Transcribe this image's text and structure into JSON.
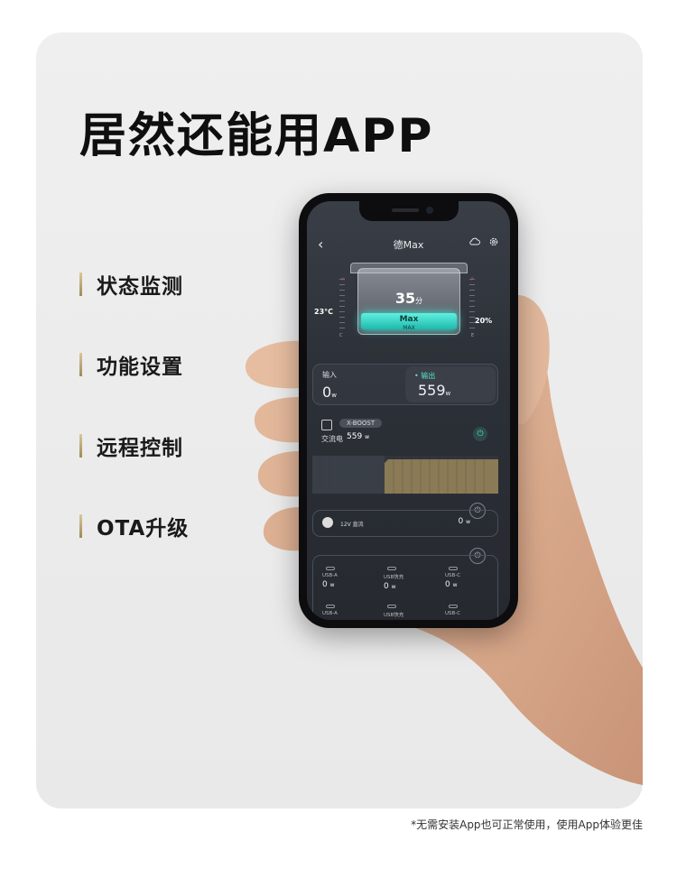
{
  "headline": "居然还能用APP",
  "features": [
    "状态监测",
    "功能设置",
    "远程控制",
    "OTA升级"
  ],
  "footnote": "*无需安装App也可正常使用，使用App体验更佳",
  "app": {
    "back_icon": "chevron-left-icon",
    "title": "德Max",
    "cloud_icon": "cloud-sync-icon",
    "settings_icon": "gear-icon",
    "device": {
      "time_value": "35",
      "time_unit": "分",
      "name": "Max",
      "label": "MAX",
      "temperature": "23°C",
      "battery": "20%",
      "gauge_left_top": "H",
      "gauge_left_bottom": "C",
      "gauge_right_top": "F",
      "gauge_right_bottom": "E"
    },
    "input": {
      "label": "输入",
      "value": "0",
      "unit": "w"
    },
    "output": {
      "label": "• 输出",
      "value": "559",
      "unit": "w"
    },
    "ac": {
      "badge": "X-BOOST",
      "label": "交流电",
      "value": "559",
      "unit": "w",
      "power_on": "⏻"
    },
    "dc": {
      "label": "12V 直流",
      "value": "0",
      "unit": "w",
      "power": "⏻"
    },
    "usb_power": "⏻",
    "usb_ports": [
      {
        "label": "USB-A",
        "value": "0",
        "unit": "w"
      },
      {
        "label": "USB快充",
        "value": "0",
        "unit": "w"
      },
      {
        "label": "USB-C",
        "value": "0",
        "unit": "w"
      },
      {
        "label": "USB-A",
        "value": "",
        "unit": ""
      },
      {
        "label": "USB快充",
        "value": "",
        "unit": ""
      },
      {
        "label": "USB-C",
        "value": "",
        "unit": ""
      }
    ],
    "colors": {
      "accent": "#4fe0d0",
      "chart_fill": "#8a7a55",
      "background": "#2c3037"
    }
  }
}
